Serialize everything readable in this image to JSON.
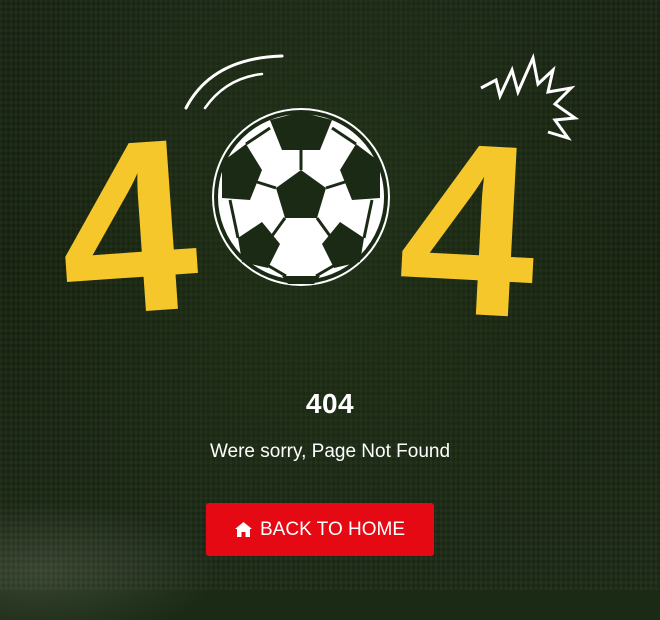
{
  "page": {
    "title": "404",
    "message": "Were sorry, Page Not Found"
  },
  "button": {
    "label": "BACK TO HOME",
    "icon": "home-icon"
  },
  "hero": {
    "digit_left": "4",
    "digit_right": "4",
    "ball_icon": "soccer-ball-icon",
    "digit_color": "#f5c72b"
  },
  "colors": {
    "background": "#1b2a15",
    "button": "#e50914",
    "text": "#ffffff"
  }
}
